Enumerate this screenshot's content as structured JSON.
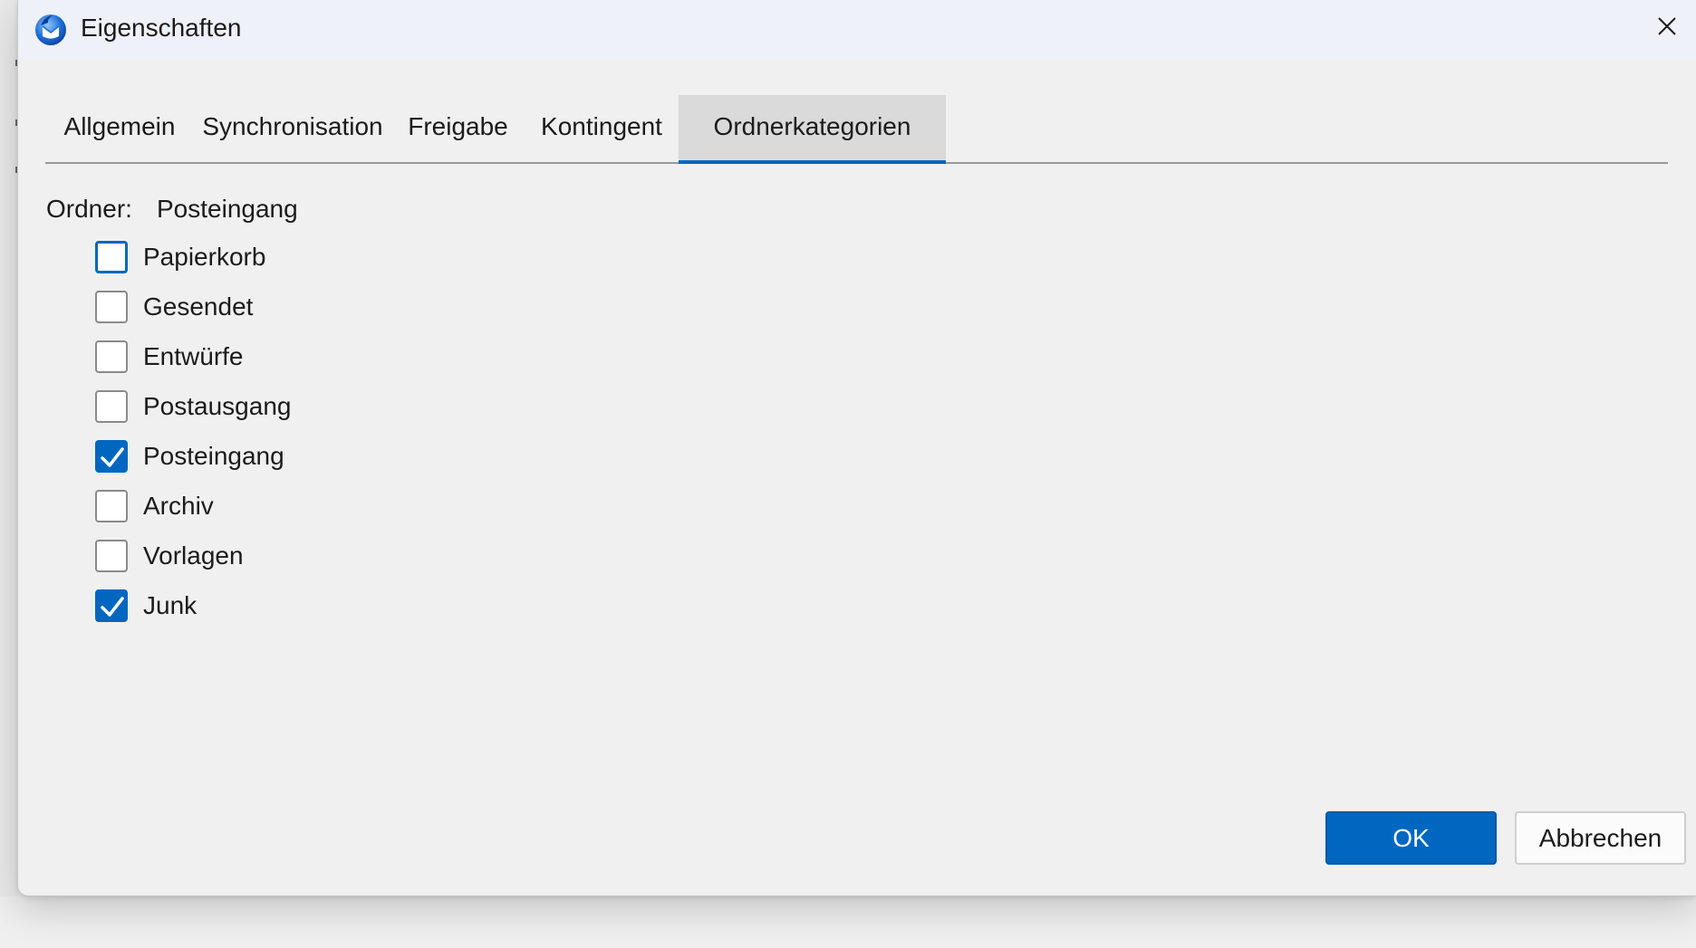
{
  "window": {
    "title": "Eigenschaften",
    "icon": "thunderbird-app-icon",
    "close_icon": "close-icon"
  },
  "tabs": [
    {
      "label": "Allgemein",
      "active": false
    },
    {
      "label": "Synchronisation",
      "active": false
    },
    {
      "label": "Freigabe",
      "active": false
    },
    {
      "label": "Kontingent",
      "active": false
    },
    {
      "label": "Ordnerkategorien",
      "active": true
    }
  ],
  "folder": {
    "label": "Ordner:",
    "value": "Posteingang"
  },
  "categories": [
    {
      "label": "Papierkorb",
      "checked": false,
      "focused": true
    },
    {
      "label": "Gesendet",
      "checked": false,
      "focused": false
    },
    {
      "label": "Entwürfe",
      "checked": false,
      "focused": false
    },
    {
      "label": "Postausgang",
      "checked": false,
      "focused": false
    },
    {
      "label": "Posteingang",
      "checked": true,
      "focused": false
    },
    {
      "label": "Archiv",
      "checked": false,
      "focused": false
    },
    {
      "label": "Vorlagen",
      "checked": false,
      "focused": false
    },
    {
      "label": "Junk",
      "checked": true,
      "focused": false
    }
  ],
  "buttons": {
    "ok": "OK",
    "cancel": "Abbrechen"
  },
  "colors": {
    "accent": "#0067c0",
    "titlebar": "#eef1f8",
    "dialog_bg": "#f0f0f0",
    "active_tab_bg": "#dadada"
  }
}
